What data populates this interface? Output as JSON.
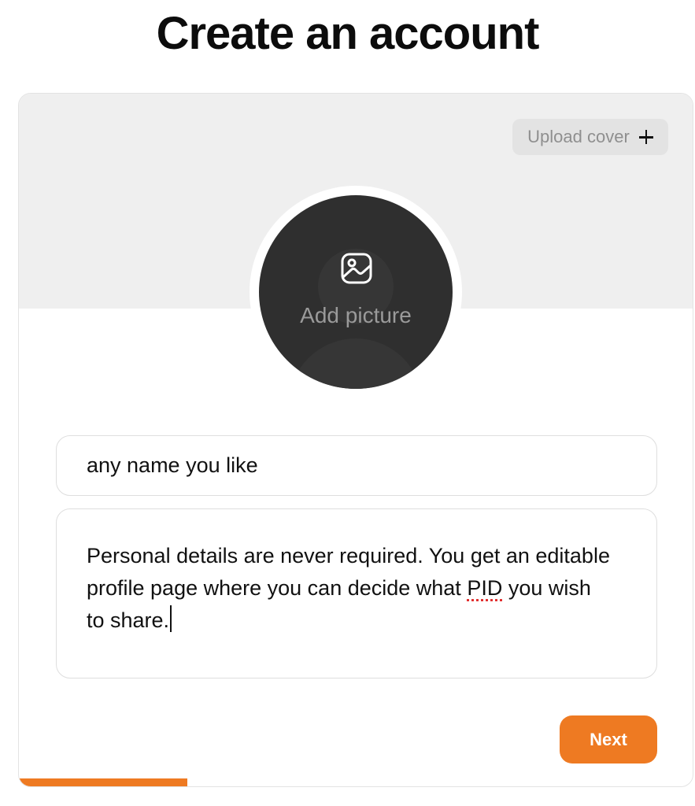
{
  "page": {
    "title": "Create an account"
  },
  "cover": {
    "upload_label": "Upload cover",
    "upload_icon": "plus-icon"
  },
  "avatar": {
    "label": "Add picture",
    "icon": "image-icon"
  },
  "form": {
    "name_value": "any name you like",
    "bio_before": "Personal details are never required. You get an editable profile page where you can decide what ",
    "bio_misspelled": "PID",
    "bio_after": " you wish to share."
  },
  "actions": {
    "next_label": "Next"
  },
  "progress": {
    "value": 0.25
  },
  "colors": {
    "accent": "#ee7a22",
    "cover_bg": "#efefef",
    "avatar_bg": "#2f2f2f"
  }
}
